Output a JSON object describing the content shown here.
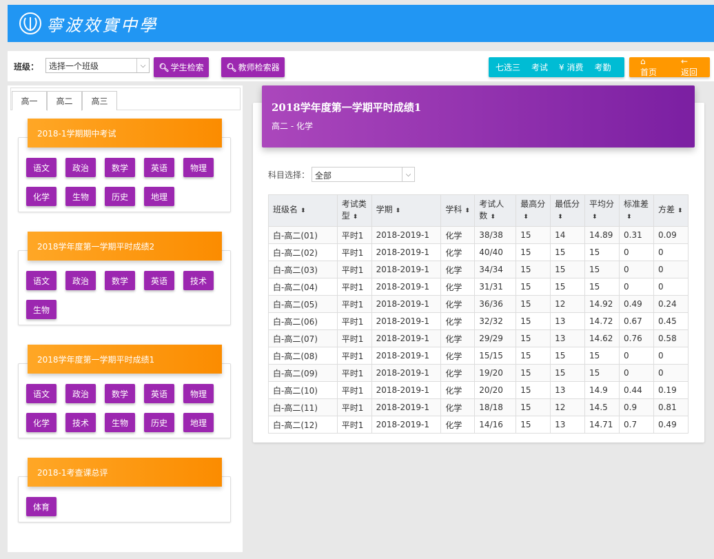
{
  "header": {
    "logo_text": "寧波效實中學"
  },
  "toolbar": {
    "class_label": "班级：",
    "class_select_value": "选择一个班级",
    "student_search": "学生检索",
    "teacher_search": "教师检索器",
    "cyan_buttons": [
      "七选三",
      "考试",
      "¥ 消费",
      "考勤"
    ],
    "home": "首页",
    "back": "返回"
  },
  "grade_tabs": [
    "高一",
    "高二",
    "高三"
  ],
  "exams": [
    {
      "title": "2018-1学期期中考试",
      "subjects": [
        "语文",
        "政治",
        "数学",
        "英语",
        "物理",
        "化学",
        "生物",
        "历史",
        "地理"
      ]
    },
    {
      "title": "2018学年度第一学期平时成绩2",
      "subjects": [
        "语文",
        "政治",
        "数学",
        "英语",
        "技术",
        "生物"
      ]
    },
    {
      "title": "2018学年度第一学期平时成绩1",
      "subjects": [
        "语文",
        "政治",
        "数学",
        "英语",
        "物理",
        "化学",
        "技术",
        "生物",
        "历史",
        "地理"
      ]
    },
    {
      "title": "2018-1考查课总评",
      "subjects": [
        "体育"
      ]
    }
  ],
  "report": {
    "title": "2018学年度第一学期平时成绩1",
    "subtitle": "高二 - 化学",
    "subject_select_label": "科目选择：",
    "subject_select_value": "全部"
  },
  "table": {
    "columns": [
      "班级名",
      "考试类型",
      "学期",
      "学科",
      "考试人数",
      "最高分",
      "最低分",
      "平均分",
      "标准差",
      "方差"
    ],
    "rows": [
      [
        "白-高二(01)",
        "平时1",
        "2018-2019-1",
        "化学",
        "38/38",
        "15",
        "14",
        "14.89",
        "0.31",
        "0.09"
      ],
      [
        "白-高二(02)",
        "平时1",
        "2018-2019-1",
        "化学",
        "40/40",
        "15",
        "15",
        "15",
        "0",
        "0"
      ],
      [
        "白-高二(03)",
        "平时1",
        "2018-2019-1",
        "化学",
        "34/34",
        "15",
        "15",
        "15",
        "0",
        "0"
      ],
      [
        "白-高二(04)",
        "平时1",
        "2018-2019-1",
        "化学",
        "31/31",
        "15",
        "15",
        "15",
        "0",
        "0"
      ],
      [
        "白-高二(05)",
        "平时1",
        "2018-2019-1",
        "化学",
        "36/36",
        "15",
        "12",
        "14.92",
        "0.49",
        "0.24"
      ],
      [
        "白-高二(06)",
        "平时1",
        "2018-2019-1",
        "化学",
        "32/32",
        "15",
        "13",
        "14.72",
        "0.67",
        "0.45"
      ],
      [
        "白-高二(07)",
        "平时1",
        "2018-2019-1",
        "化学",
        "29/29",
        "15",
        "13",
        "14.62",
        "0.76",
        "0.58"
      ],
      [
        "白-高二(08)",
        "平时1",
        "2018-2019-1",
        "化学",
        "15/15",
        "15",
        "15",
        "15",
        "0",
        "0"
      ],
      [
        "白-高二(09)",
        "平时1",
        "2018-2019-1",
        "化学",
        "19/20",
        "15",
        "15",
        "15",
        "0",
        "0"
      ],
      [
        "白-高二(10)",
        "平时1",
        "2018-2019-1",
        "化学",
        "20/20",
        "15",
        "13",
        "14.9",
        "0.44",
        "0.19"
      ],
      [
        "白-高二(11)",
        "平时1",
        "2018-2019-1",
        "化学",
        "18/18",
        "15",
        "12",
        "14.5",
        "0.9",
        "0.81"
      ],
      [
        "白-高二(12)",
        "平时1",
        "2018-2019-1",
        "化学",
        "14/16",
        "15",
        "13",
        "14.71",
        "0.7",
        "0.49"
      ]
    ]
  }
}
